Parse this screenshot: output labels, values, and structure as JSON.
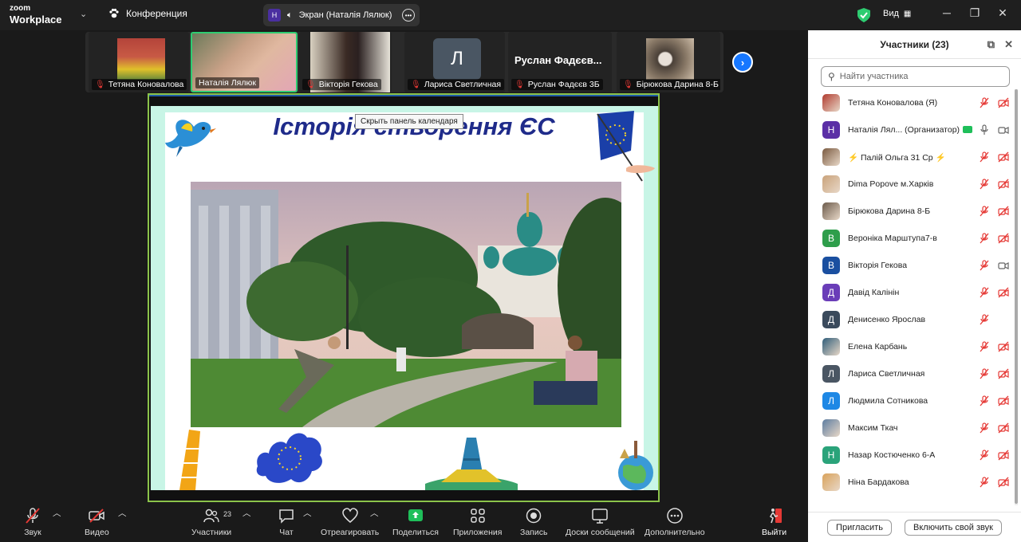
{
  "app": {
    "brand_line1": "zoom",
    "brand_line2": "Workplace",
    "meeting_title": "Конференция",
    "share_label": "Экран (Наталія Лялюк)",
    "share_avatar_letter": "Н",
    "view_label": "Вид"
  },
  "strip": {
    "tiles": [
      {
        "name": "Тетяна Коновалова",
        "muted": true
      },
      {
        "name": "Наталія Лялюк",
        "muted": false,
        "active": true
      },
      {
        "name": "Вікторія Гекова",
        "muted": true
      },
      {
        "name": "Лариса Светличная",
        "muted": true,
        "letter": "Л"
      },
      {
        "name": "Руслан Фадєєв 3Б",
        "muted": true,
        "big_name": "Руслан  Фадєєв..."
      },
      {
        "name": "Бірюкова Дарина 8-Б",
        "muted": true
      }
    ]
  },
  "slide": {
    "title": "Історія створення ЄС",
    "tooltip": "Скрыть панель календаря"
  },
  "panel": {
    "title": "Участники (23)",
    "search_placeholder": "Найти участника",
    "participants": [
      {
        "name": "Тетяна Коновалова (Я)",
        "avatar": "photo",
        "color": "#b03a2e",
        "mic": "muted",
        "video": "off"
      },
      {
        "name": "Наталія Лял...  (Организатор)",
        "avatar": "Н",
        "color": "#5b2fa6",
        "mic": "on",
        "video": "on"
      },
      {
        "name": "⚡ Палій Ольга 31 Ср ⚡",
        "avatar": "photo",
        "color": "#7a5a40",
        "mic": "muted",
        "video": "off"
      },
      {
        "name": "Dima Popove  м.Харків",
        "avatar": "photo",
        "color": "#c9a27a",
        "mic": "muted",
        "video": "off"
      },
      {
        "name": "Бірюкова Дарина 8-Б",
        "avatar": "photo",
        "color": "#6b5a4a",
        "mic": "muted",
        "video": "off"
      },
      {
        "name": "Вероніка Марштупа7-в",
        "avatar": "В",
        "color": "#2e9e4b",
        "mic": "muted",
        "video": "off"
      },
      {
        "name": "Вікторія Гекова",
        "avatar": "В",
        "color": "#1a4fa0",
        "mic": "muted",
        "video": "on"
      },
      {
        "name": "Давід Калінін",
        "avatar": "Д",
        "color": "#6a3db8",
        "mic": "muted",
        "video": "off"
      },
      {
        "name": "Денисенко Ярослав",
        "avatar": "Д",
        "color": "#3a4a5c",
        "mic": "muted",
        "video": "none"
      },
      {
        "name": "Елена Карбань",
        "avatar": "photo",
        "color": "#2f5d7a",
        "mic": "muted",
        "video": "off"
      },
      {
        "name": "Лариса Светличная",
        "avatar": "Л",
        "color": "#4a5663",
        "mic": "muted",
        "video": "off"
      },
      {
        "name": "Людмила Сотникова",
        "avatar": "Л",
        "color": "#1e88e5",
        "mic": "muted",
        "video": "off"
      },
      {
        "name": "Максим Ткач",
        "avatar": "photo",
        "color": "#5d7da0",
        "mic": "muted",
        "video": "off"
      },
      {
        "name": "Назар Костюченко 6-А",
        "avatar": "Н",
        "color": "#2aa37a",
        "mic": "muted",
        "video": "off"
      },
      {
        "name": "Ніна Бардакова",
        "avatar": "photo",
        "color": "#d9a25a",
        "mic": "muted",
        "video": "off"
      }
    ],
    "invite_label": "Пригласить",
    "unmute_label": "Включить свой звук"
  },
  "toolbar": {
    "audio": "Звук",
    "video": "Видео",
    "participants": "Участники",
    "participants_count": "23",
    "chat": "Чат",
    "react": "Отреагировать",
    "share": "Поделиться",
    "apps": "Приложения",
    "record": "Запись",
    "whiteboards": "Доски сообщений",
    "more": "Дополнительно",
    "leave": "Выйти"
  },
  "colors": {
    "accent_green": "#2ecc71",
    "muted_red": "#e53935",
    "share_green": "#1fbf5a",
    "blue": "#1677ff"
  }
}
